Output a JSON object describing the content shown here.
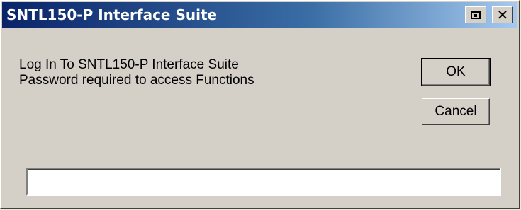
{
  "window": {
    "title": "SNTL150-P Interface Suite"
  },
  "titlebar_icons": {
    "restore": "restore-icon",
    "close": "close-icon"
  },
  "message": {
    "line1": "Log In To SNTL150-P Interface Suite",
    "line2": "Password required to access Functions"
  },
  "buttons": {
    "ok_label": "OK",
    "cancel_label": "Cancel"
  },
  "password_field": {
    "value": "",
    "placeholder": ""
  },
  "colors": {
    "titlebar_start": "#0a246a",
    "titlebar_end": "#a6caf0",
    "window_bg": "#d4d0c8"
  }
}
